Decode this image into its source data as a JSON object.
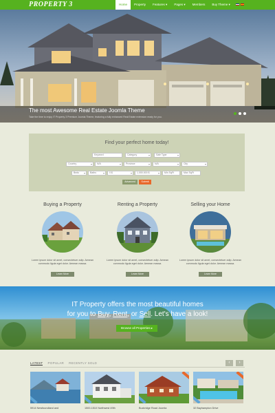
{
  "header": {
    "logo": "PROPERTY 3",
    "nav": [
      "Home",
      "Property",
      "Features ▾",
      "Pages ▾",
      "Members",
      "Buy Theme ▾"
    ],
    "active_nav": "Home",
    "brand_color": "#56b21f"
  },
  "hero": {
    "title": "The most Awesome Real Estate Joomla Theme",
    "subtitle": "Take the time to enjoy IT Property 3 Premium Joomla Theme, featuring a fully enhanced Real Estate extension ready for you."
  },
  "search": {
    "title": "Find your perfect home today!",
    "keyword_placeholder": "Keyword",
    "category": "Category",
    "sale_type": "Sale Type",
    "country": "Country",
    "province": "Province",
    "city": "City",
    "na1": "N/A",
    "na2": "N/A",
    "beds": "Beds",
    "baths": "Baths",
    "min_price": "0 $",
    "max_price": "1.000.000 $",
    "min_sqft": "Min SqFt",
    "max_sqft": "Max SqFt",
    "advanced_label": "Advanced",
    "submit_label": "Submit"
  },
  "features": [
    {
      "title": "Buying a Property",
      "text": "Lorem ipsum dolor sit amet, consectetuer adip. Aenean commodo ligula eget dolor. Aenean massa.",
      "button": "Learn More"
    },
    {
      "title": "Renting a Property",
      "text": "Lorem ipsum dolor sit amet, consectetuer adip. Aenean commodo ligula eget dolor. Aenean massa.",
      "button": "Learn More"
    },
    {
      "title": "Selling your Home",
      "text": "Lorem ipsum dolor sit amet, consectetuer adip. Aenean commodo ligula eget dolor. Aenean massa.",
      "button": "Learn More"
    }
  ],
  "cta": {
    "line1": "IT Property offers the most beautiful homes",
    "line2_prefix": "for you to ",
    "buy": "Buy",
    "sep1": ", ",
    "rent": "Rent",
    "sep2": ", or ",
    "sell": "Sell",
    "line2_suffix": ". Let's have a look!",
    "button": "Browse all Properties ▸"
  },
  "listings": {
    "tabs": [
      "LATEST",
      "POPULAR",
      "RECENTLY SOLD"
    ],
    "active_tab": "LATEST",
    "prev": "‹",
    "next": "›",
    "cards": [
      {
        "address": "5914 Newfoundland and"
      },
      {
        "address": "1500-1510 Northwest 49th"
      },
      {
        "address": "Buckridge Road Joomla"
      },
      {
        "address": "32 Bayhampton Drive"
      }
    ]
  }
}
